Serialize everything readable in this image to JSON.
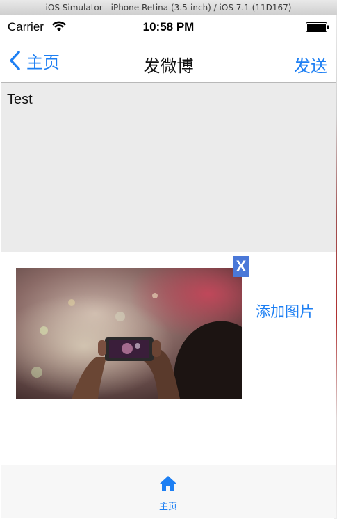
{
  "window": {
    "title": "iOS Simulator - iPhone Retina (3.5-inch) / iOS 7.1 (11D167)"
  },
  "status_bar": {
    "carrier": "Carrier",
    "time": "10:58 PM"
  },
  "nav": {
    "back_label": "主页",
    "title": "发微博",
    "send_label": "发送"
  },
  "compose": {
    "text": "Test"
  },
  "attachments": {
    "remove_label": "X",
    "add_label": "添加图片"
  },
  "tab_bar": {
    "items": [
      {
        "label": "主页",
        "icon": "home-icon",
        "selected": true
      }
    ]
  },
  "colors": {
    "accent": "#1d7ff3",
    "text_bg": "#ebebeb",
    "remove_bg": "#4a78d8"
  }
}
